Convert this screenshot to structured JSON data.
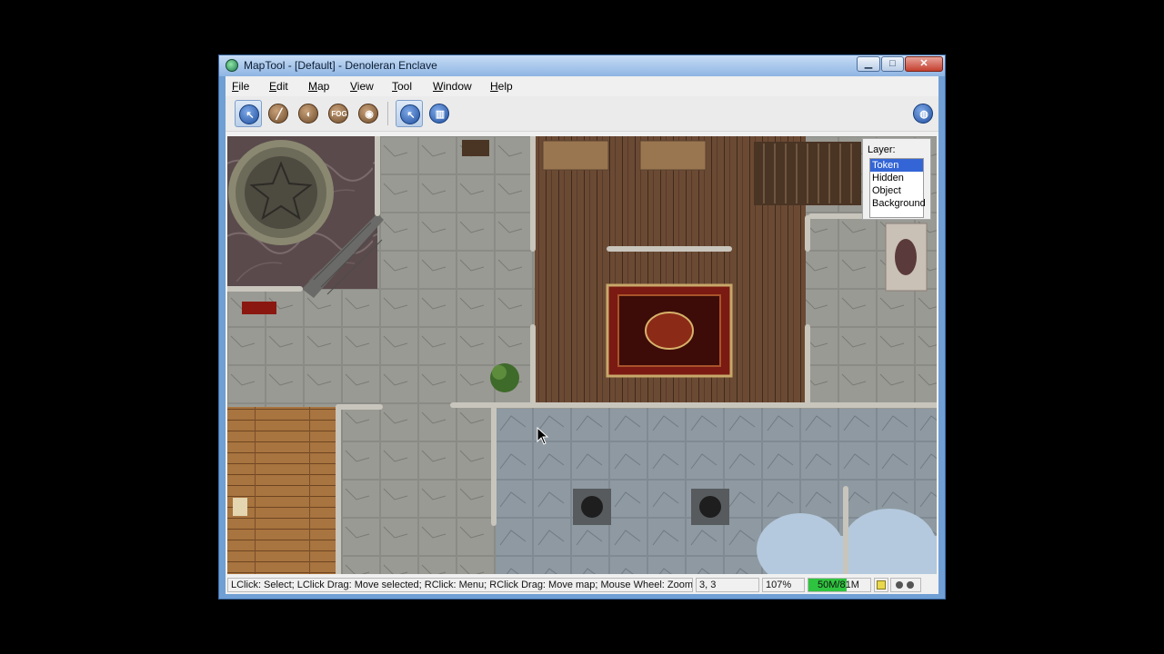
{
  "window": {
    "title": "MapTool - [Default]  - Denoleran Enclave",
    "minimize": "▁",
    "maximize": "□",
    "close": "✕"
  },
  "menu": [
    {
      "label": "File",
      "ul": "F",
      "rest": "ile"
    },
    {
      "label": "Edit",
      "ul": "E",
      "rest": "dit"
    },
    {
      "label": "Map",
      "ul": "M",
      "rest": "ap"
    },
    {
      "label": "View",
      "ul": "V",
      "rest": "iew"
    },
    {
      "label": "Tool",
      "ul": "T",
      "rest": "ool"
    },
    {
      "label": "Window",
      "ul": "W",
      "rest": "indow"
    },
    {
      "label": "Help",
      "ul": "H",
      "rest": "elp"
    }
  ],
  "toolbar": {
    "tools": [
      {
        "icon": "pointer-icon",
        "active": true
      },
      {
        "icon": "draw-icon"
      },
      {
        "icon": "template-icon"
      },
      {
        "icon": "fog-icon",
        "label": "FOG"
      },
      {
        "icon": "vision-icon"
      },
      {
        "icon": "select-pointer-icon",
        "active": true
      },
      {
        "icon": "measure-icon"
      },
      {
        "icon": "globe-icon"
      }
    ]
  },
  "layers": {
    "title": "Layer:",
    "options": [
      "Token",
      "Hidden",
      "Object",
      "Background"
    ],
    "selected": "Token"
  },
  "status": {
    "hint": "LClick: Select; LClick Drag: Move selected; RClick: Menu; RClick Drag: Move map; Mouse Wheel: Zoom; ...",
    "coords": "3, 3",
    "zoom": "107%",
    "memory": "50M/81M",
    "memory_fraction": 0.62
  },
  "colors": {
    "accent": "#3465d6",
    "memory": "#2fc43f",
    "carpet": "#7a1a12",
    "wood": "#6b4a34"
  }
}
